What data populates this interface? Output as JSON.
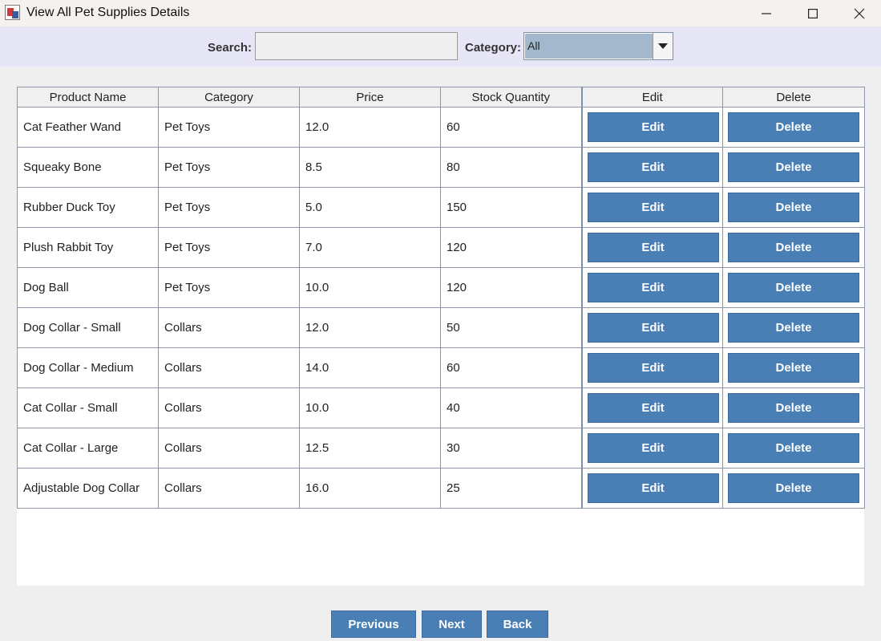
{
  "window": {
    "title": "View All Pet Supplies Details",
    "controls": [
      "minimize-icon",
      "maximize-icon",
      "close-icon"
    ]
  },
  "toolbar": {
    "search_label": "Search:",
    "search_value": "",
    "category_label": "Category:",
    "category_selected": "All"
  },
  "table": {
    "headers": [
      "Product Name",
      "Category",
      "Price",
      "Stock Quantity",
      "Edit",
      "Delete"
    ],
    "rows": [
      {
        "name": "Cat Feather Wand",
        "category": "Pet Toys",
        "price": "12.0",
        "stock": "60",
        "edit": "Edit",
        "delete": "Delete"
      },
      {
        "name": "Squeaky Bone",
        "category": "Pet Toys",
        "price": "8.5",
        "stock": "80",
        "edit": "Edit",
        "delete": "Delete"
      },
      {
        "name": "Rubber Duck Toy",
        "category": "Pet Toys",
        "price": "5.0",
        "stock": "150",
        "edit": "Edit",
        "delete": "Delete"
      },
      {
        "name": "Plush Rabbit Toy",
        "category": "Pet Toys",
        "price": "7.0",
        "stock": "120",
        "edit": "Edit",
        "delete": "Delete"
      },
      {
        "name": "Dog Ball",
        "category": "Pet Toys",
        "price": "10.0",
        "stock": "120",
        "edit": "Edit",
        "delete": "Delete"
      },
      {
        "name": "Dog Collar - Small",
        "category": "Collars",
        "price": "12.0",
        "stock": "50",
        "edit": "Edit",
        "delete": "Delete"
      },
      {
        "name": "Dog Collar - Medium",
        "category": "Collars",
        "price": "14.0",
        "stock": "60",
        "edit": "Edit",
        "delete": "Delete"
      },
      {
        "name": "Cat Collar - Small",
        "category": "Collars",
        "price": "10.0",
        "stock": "40",
        "edit": "Edit",
        "delete": "Delete"
      },
      {
        "name": "Cat Collar - Large",
        "category": "Collars",
        "price": "12.5",
        "stock": "30",
        "edit": "Edit",
        "delete": "Delete"
      },
      {
        "name": "Adjustable Dog Collar",
        "category": "Collars",
        "price": "16.0",
        "stock": "25",
        "edit": "Edit",
        "delete": "Delete"
      }
    ]
  },
  "nav": {
    "previous": "Previous",
    "next": "Next",
    "back": "Back"
  },
  "colors": {
    "button": "#4a7fb5",
    "toolbar_bg": "#e6e6f7",
    "select_highlight": "#a3b8cc"
  }
}
